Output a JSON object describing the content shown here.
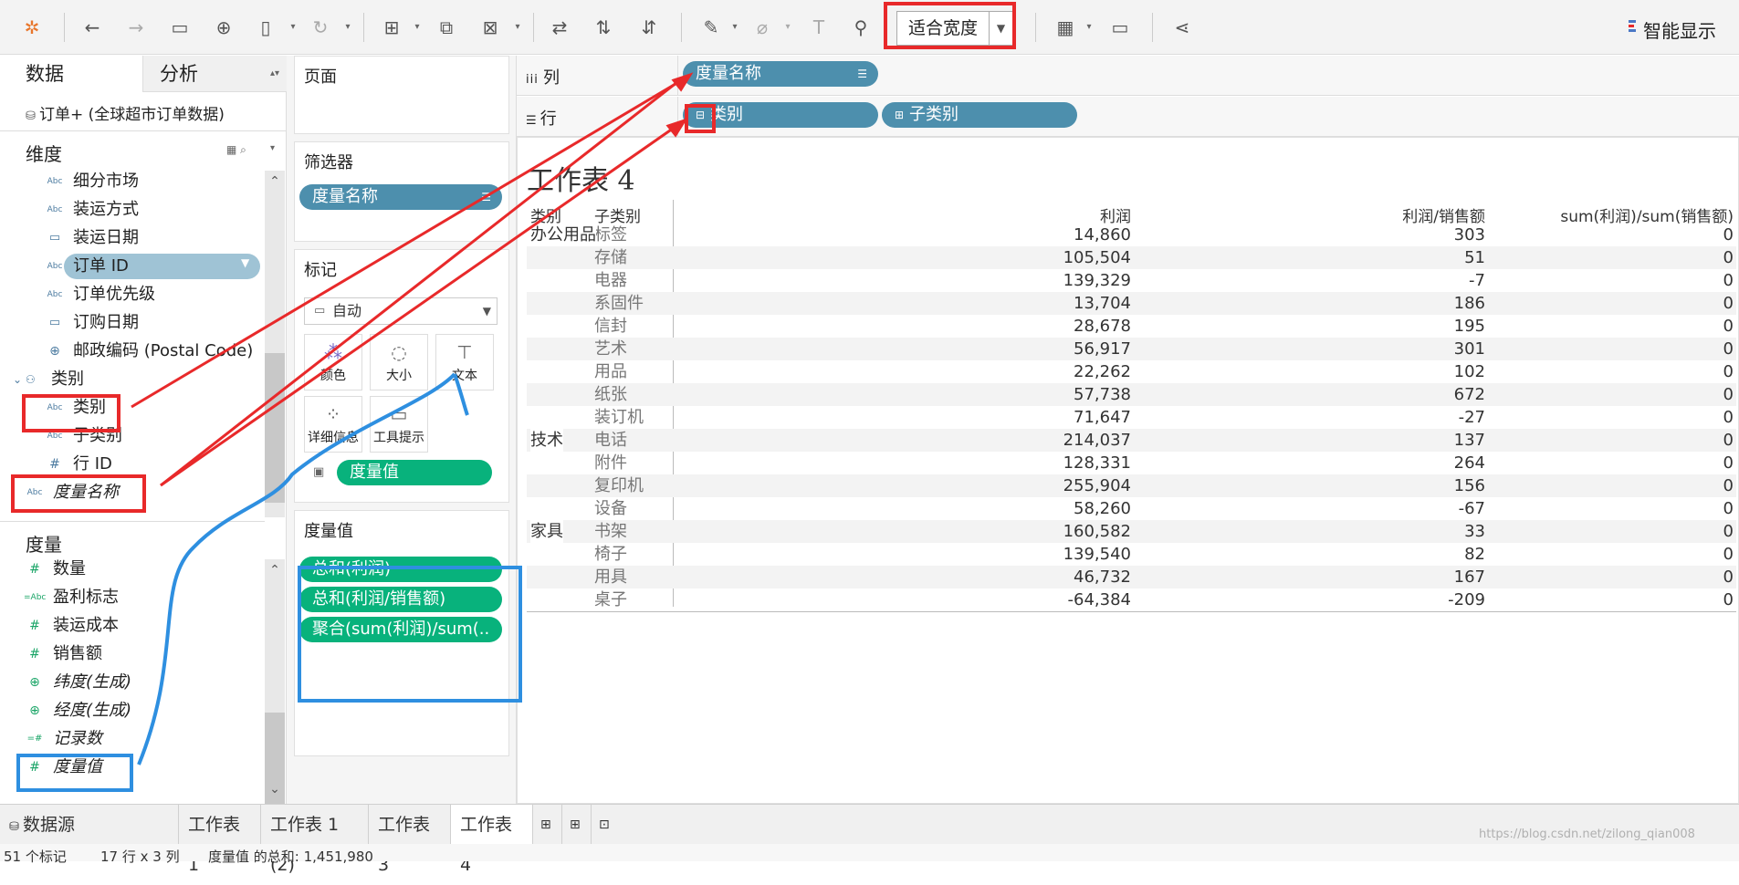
{
  "toolbar": {
    "fit_label": "适合宽度",
    "smart_label": "智能显示"
  },
  "left": {
    "tab_data": "数据",
    "tab_analysis": "分析",
    "source": "订单+ (全球超市订单数据)",
    "dimensions_header": "维度",
    "dimensions": [
      {
        "icon": "Abc",
        "label": "细分市场"
      },
      {
        "icon": "Abc",
        "label": "装运方式"
      },
      {
        "icon": "calendar",
        "label": "装运日期"
      },
      {
        "icon": "Abc",
        "label": "订单 ID"
      },
      {
        "icon": "Abc",
        "label": "订单优先级"
      },
      {
        "icon": "calendar",
        "label": "订购日期"
      },
      {
        "icon": "globe",
        "label": "邮政编码 (Postal Code)"
      }
    ],
    "hierarchy": "类别",
    "hierarchy_items": [
      {
        "icon": "Abc",
        "label": "类别"
      },
      {
        "icon": "Abc",
        "label": "子类别"
      },
      {
        "icon": "#",
        "label": "行 ID"
      }
    ],
    "measure_names_field": "度量名称",
    "measures_header": "度量",
    "measures": [
      {
        "icon": "#",
        "label": "数量"
      },
      {
        "icon": "=Abc",
        "label": "盈利标志"
      },
      {
        "icon": "#",
        "label": "装运成本"
      },
      {
        "icon": "#",
        "label": "销售额"
      },
      {
        "icon": "globe",
        "label": "纬度(生成)"
      },
      {
        "icon": "globe",
        "label": "经度(生成)"
      },
      {
        "icon": "=#",
        "label": "记录数"
      },
      {
        "icon": "#",
        "label": "度量值"
      }
    ]
  },
  "mid": {
    "pages_title": "页面",
    "filters_title": "筛选器",
    "filter_pill": "度量名称",
    "marks_title": "标记",
    "marks_type": "自动",
    "mark_buttons": [
      "颜色",
      "大小",
      "文本",
      "详细信息",
      "工具提示"
    ],
    "marks_pill": "度量值",
    "measure_values_title": "度量值",
    "measure_values": [
      "总和(利润)",
      "总和(利润/销售额)",
      "聚合(sum(利润)/sum(.."
    ]
  },
  "shelves": {
    "columns_label": "列",
    "columns_pill": "度量名称",
    "rows_label": "行",
    "rows_pills": [
      "类别",
      "子类别"
    ]
  },
  "worksheet": {
    "title": "工作表 4",
    "headers": [
      "类别",
      "子类别",
      "利润",
      "利润/销售额",
      "sum(利润)/sum(销售额)"
    ],
    "groups": [
      {
        "category": "办公用品",
        "rows": [
          {
            "sub": "标签",
            "profit": "14,860",
            "ratio": "303",
            "agg": "0"
          },
          {
            "sub": "存储",
            "profit": "105,504",
            "ratio": "51",
            "agg": "0"
          },
          {
            "sub": "电器",
            "profit": "139,329",
            "ratio": "-7",
            "agg": "0"
          },
          {
            "sub": "系固件",
            "profit": "13,704",
            "ratio": "186",
            "agg": "0"
          },
          {
            "sub": "信封",
            "profit": "28,678",
            "ratio": "195",
            "agg": "0"
          },
          {
            "sub": "艺术",
            "profit": "56,917",
            "ratio": "301",
            "agg": "0"
          },
          {
            "sub": "用品",
            "profit": "22,262",
            "ratio": "102",
            "agg": "0"
          },
          {
            "sub": "纸张",
            "profit": "57,738",
            "ratio": "672",
            "agg": "0"
          },
          {
            "sub": "装订机",
            "profit": "71,647",
            "ratio": "-27",
            "agg": "0"
          }
        ]
      },
      {
        "category": "技术",
        "rows": [
          {
            "sub": "电话",
            "profit": "214,037",
            "ratio": "137",
            "agg": "0"
          },
          {
            "sub": "附件",
            "profit": "128,331",
            "ratio": "264",
            "agg": "0"
          },
          {
            "sub": "复印机",
            "profit": "255,904",
            "ratio": "156",
            "agg": "0"
          },
          {
            "sub": "设备",
            "profit": "58,260",
            "ratio": "-67",
            "agg": "0"
          }
        ]
      },
      {
        "category": "家具",
        "rows": [
          {
            "sub": "书架",
            "profit": "160,582",
            "ratio": "33",
            "agg": "0"
          },
          {
            "sub": "椅子",
            "profit": "139,540",
            "ratio": "82",
            "agg": "0"
          },
          {
            "sub": "用具",
            "profit": "46,732",
            "ratio": "167",
            "agg": "0"
          },
          {
            "sub": "桌子",
            "profit": "-64,384",
            "ratio": "-209",
            "agg": "0"
          }
        ]
      }
    ]
  },
  "bottom": {
    "tabs": [
      "数据源",
      "工作表 1",
      "工作表 1 (2)",
      "工作表 3",
      "工作表 4"
    ],
    "active_tab": "工作表 4"
  },
  "status": {
    "marks": "51 个标记",
    "dims": "17 行 x 3 列",
    "sum": "度量值 的总和: 1,451,980",
    "watermark": "https://blog.csdn.net/zilong_qian008"
  }
}
